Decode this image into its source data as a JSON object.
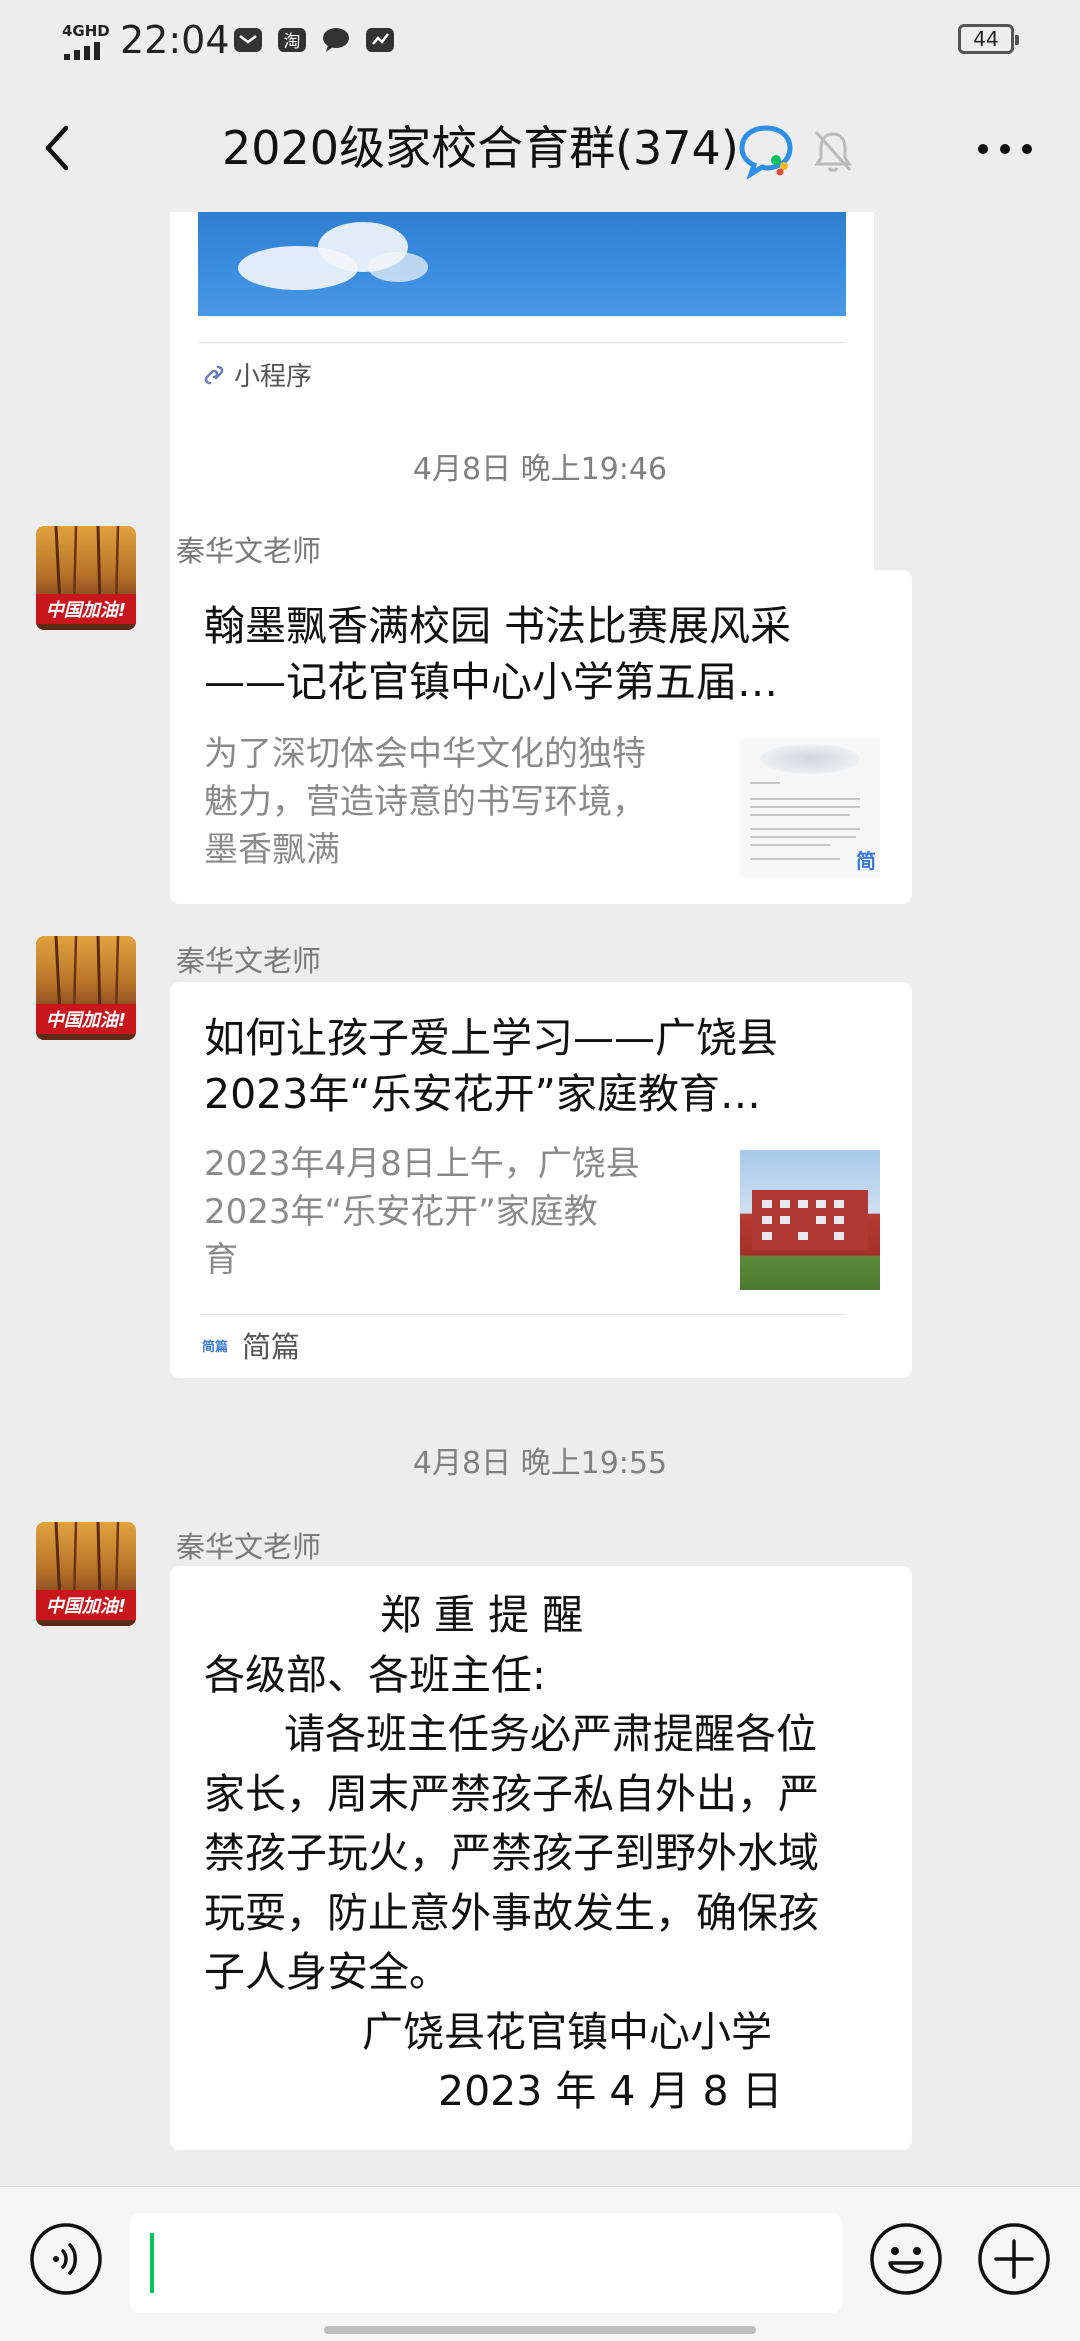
{
  "status_bar": {
    "network": "4GHD",
    "time": "22:04",
    "battery": "44"
  },
  "header": {
    "title": "2020级家校合育群(374)"
  },
  "mini_program_card": {
    "footer_label": "小程序"
  },
  "timestamps": [
    "4月8日 晚上19:46",
    "4月8日 晚上19:55"
  ],
  "messages": [
    {
      "sender": "秦华文老师",
      "avatar_text": "中国加油!",
      "title_line1": "翰墨飘香满校园 书法比赛展风采",
      "title_line2": "——记花官镇中心小学第五届…",
      "desc_lines": [
        "为了深切体会中华文化的独特",
        "魅力，营造诗意的书写环境，",
        "墨香飘满"
      ],
      "thumb_badge": "简"
    },
    {
      "sender": "秦华文老师",
      "avatar_text": "中国加油!",
      "title_line1": "如何让孩子爱上学习——广饶县",
      "title_line2": "2023年“乐安花开”家庭教育…",
      "desc_lines": [
        "2023年4月8日上午，广饶县",
        "2023年“乐安花开”家庭教",
        "育"
      ],
      "footer_logo": "简篇",
      "footer_label": "简篇"
    },
    {
      "sender": "秦华文老师",
      "avatar_text": "中国加油!",
      "lines": [
        "郑 重 提 醒",
        "各级部、各班主任:",
        "请各班主任务必严肃提醒各位",
        "家长，周末严禁孩子私自外出，严",
        "禁孩子玩火，严禁孩子到野外水域",
        "玩耍，防止意外事故发生，确保孩",
        "子人身安全。",
        "广饶县花官镇中心小学",
        "2023 年 4 月 8 日"
      ]
    }
  ],
  "icons": {
    "back": "back-arrow-icon",
    "chat_bubble": "chat-bubble-icon",
    "mute": "mute-bell-icon",
    "more": "more-dots-icon",
    "voice": "voice-icon",
    "emoji": "emoji-icon",
    "plus": "plus-icon"
  },
  "colors": {
    "background": "#ededed",
    "bubble": "#ffffff",
    "caret": "#07c160",
    "link_blue": "#3d7bd8"
  }
}
